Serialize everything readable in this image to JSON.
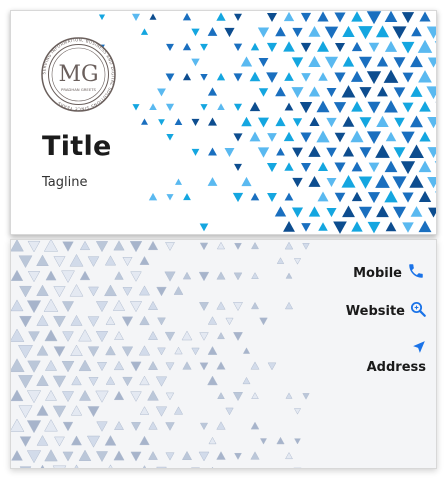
{
  "front": {
    "logo": {
      "monogram": "MG",
      "name": "PRADHAN GREETS",
      "ring_text": "SERVING INFORMATION, BUSINESS AND DIGITAL SOLUTIONS SINCE YEARS",
      "color": "#6a5f5c"
    },
    "title": "Title",
    "tagline": "Tagline",
    "pattern_colors": [
      "#1a6fbf",
      "#14a6e0",
      "#5ab9f0",
      "#0d4d8f"
    ]
  },
  "back": {
    "mobile_label": "Mobile",
    "mobile_icon": "phone-icon",
    "website_label": "Website",
    "website_icon": "search-icon",
    "address_label": "Address",
    "address_icon": "location-arrow-icon",
    "icon_color": "#1a73e8",
    "pattern_colors": [
      "#a9b8d0",
      "#c7d3e6",
      "#dfe6f1",
      "#8e9fbd"
    ]
  }
}
